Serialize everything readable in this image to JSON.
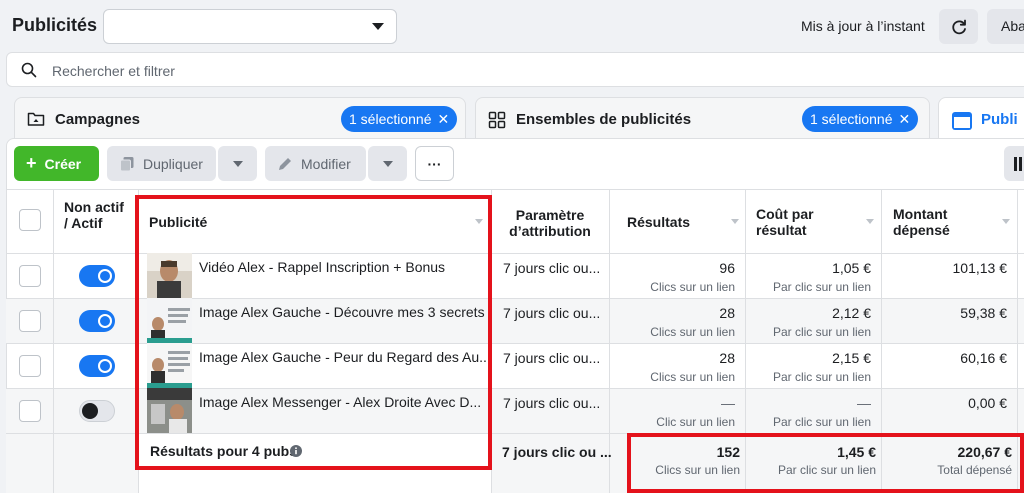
{
  "header": {
    "title": "Publicités",
    "account_value": "",
    "update_text": "Mis à jour à l’instant",
    "aba_label": "Aba"
  },
  "search": {
    "placeholder": "Rechercher et filtrer"
  },
  "tabs": [
    {
      "label": "Campagnes",
      "badge": "1 sélectionné"
    },
    {
      "label": "Ensembles de publicités",
      "badge": "1 sélectionné"
    },
    {
      "label": "Publi"
    }
  ],
  "toolbar": {
    "create": "Créer",
    "duplicate": "Dupliquer",
    "edit": "Modifier",
    "more": "···"
  },
  "columns": {
    "status": "Non actif / Actif",
    "ad": "Publicité",
    "attribution": "Paramètre d’attribution",
    "results": "Résultats",
    "cost": "Coût par résultat",
    "spent": "Montant dépensé"
  },
  "rows": [
    {
      "active": true,
      "name": "Vidéo Alex - Rappel Inscription + Bonus",
      "attribution": "7 jours clic ou...",
      "results": "96",
      "results_sub": "Clics sur un lien",
      "cost": "1,05 €",
      "cost_sub": "Par clic sur un lien",
      "spent": "101,13 €"
    },
    {
      "active": true,
      "name": "Image Alex Gauche - Découvre mes 3 secrets",
      "attribution": "7 jours clic ou...",
      "results": "28",
      "results_sub": "Clics sur un lien",
      "cost": "2,12 €",
      "cost_sub": "Par clic sur un lien",
      "spent": "59,38 €"
    },
    {
      "active": true,
      "name": "Image Alex Gauche - Peur du Regard des Au...",
      "attribution": "7 jours clic ou...",
      "results": "28",
      "results_sub": "Clics sur un lien",
      "cost": "2,15 €",
      "cost_sub": "Par clic sur un lien",
      "spent": "60,16 €"
    },
    {
      "active": false,
      "name": "Image Alex Messenger - Alex Droite Avec D...",
      "attribution": "7 jours clic ou...",
      "results": "—",
      "results_sub": "Clic sur un lien",
      "cost": "—",
      "cost_sub": "Par clic sur un lien",
      "spent": "0,00 €"
    }
  ],
  "summary": {
    "label": "Résultats pour 4 pubs",
    "attribution": "7 jours clic ou ...",
    "results": "152",
    "results_sub": "Clics sur un lien",
    "cost": "1,45 €",
    "cost_sub": "Par clic sur un lien",
    "spent": "220,67 €",
    "spent_sub": "Total dépensé"
  },
  "colors": {
    "accent": "#1877f2",
    "create": "#42b72a",
    "highlight": "#e4121b"
  }
}
